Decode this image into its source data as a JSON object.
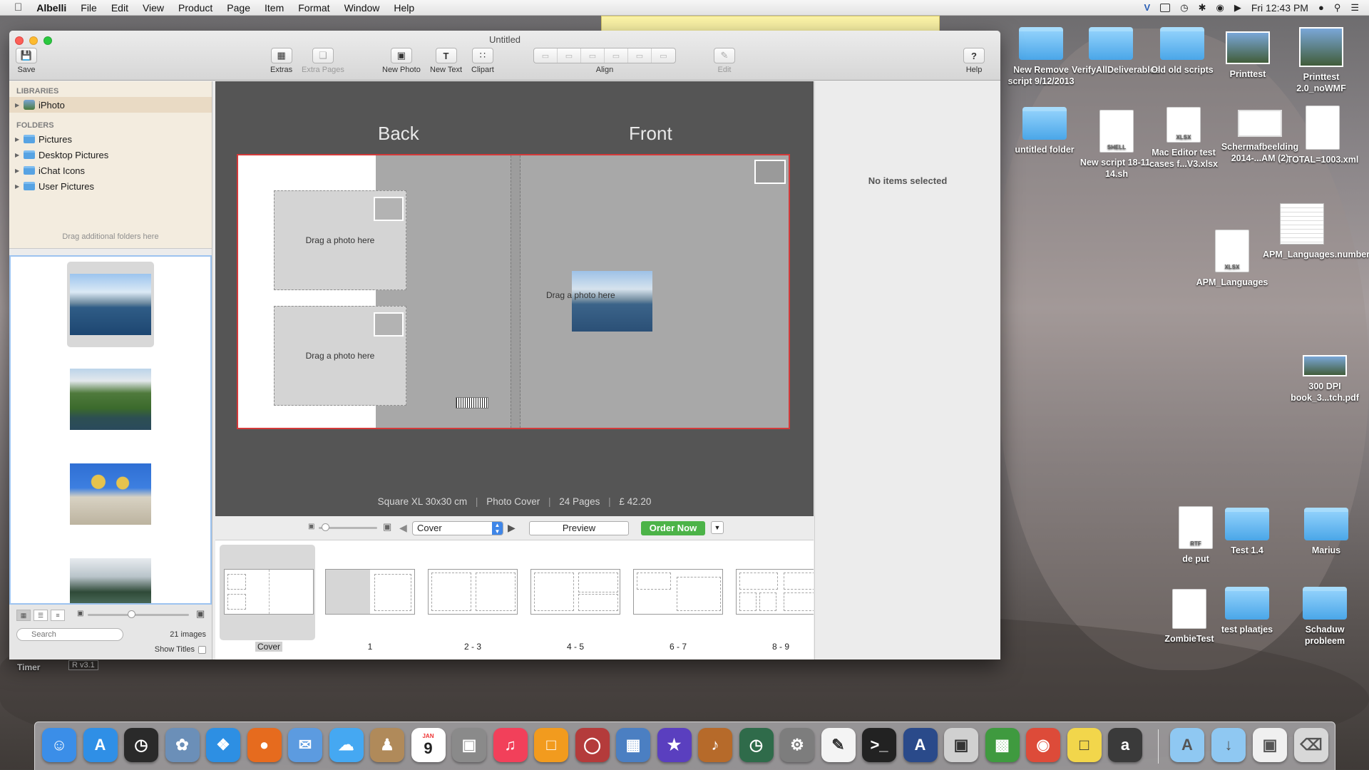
{
  "menubar": {
    "apple": "",
    "app_name": "Albelli",
    "items": [
      "File",
      "Edit",
      "View",
      "Product",
      "Page",
      "Item",
      "Format",
      "Window",
      "Help"
    ],
    "clock": "Fri 12:43 PM"
  },
  "window": {
    "title": "Untitled",
    "toolbar": {
      "save": "Save",
      "extras": "Extras",
      "extra_pages": "Extra Pages",
      "new_photo": "New Photo",
      "new_text": "New Text",
      "clipart": "Clipart",
      "align": "Align",
      "edit": "Edit",
      "help": "Help"
    }
  },
  "sidebar": {
    "libraries_header": "LIBRARIES",
    "libraries": [
      {
        "label": "iPhoto"
      }
    ],
    "folders_header": "FOLDERS",
    "folders": [
      {
        "label": "Pictures"
      },
      {
        "label": "Desktop Pictures"
      },
      {
        "label": "iChat Icons"
      },
      {
        "label": "User Pictures"
      }
    ],
    "drag_hint": "Drag additional folders here",
    "search_placeholder": "Search",
    "image_count": "21 images",
    "show_titles": "Show Titles",
    "thumbnail_size_fraction": 0.43
  },
  "editor": {
    "back_label": "Back",
    "front_label": "Front",
    "drag_photo": "Drag a photo here",
    "summary": {
      "size": "Square XL 30x30 cm",
      "cover": "Photo Cover",
      "pages": "24 Pages",
      "price": "£ 42.20"
    },
    "zoom_fraction": 0.05,
    "page_select": "Cover",
    "preview": "Preview",
    "order_now": "Order Now",
    "pages": [
      {
        "label": "Cover"
      },
      {
        "label": "1"
      },
      {
        "label": "2 - 3"
      },
      {
        "label": "4 - 5"
      },
      {
        "label": "6 - 7"
      },
      {
        "label": "8 - 9"
      }
    ]
  },
  "inspector": {
    "empty": "No items selected"
  },
  "desktop": {
    "icons": [
      {
        "label": "New Remove script 9/12/2013",
        "kind": "folder"
      },
      {
        "label": "VerifyAllDeliverables",
        "kind": "folder"
      },
      {
        "label": "Old old scripts",
        "kind": "folder"
      },
      {
        "label": "Printtest",
        "kind": "image"
      },
      {
        "label": "Printtest 2.0_noWMF",
        "kind": "image"
      },
      {
        "label": "untitled folder",
        "kind": "folder"
      },
      {
        "label": "New script 18-11-14.sh",
        "kind": "doc",
        "tag": "SHELL"
      },
      {
        "label": "Mac Editor test cases f...V3.xlsx",
        "kind": "doc",
        "tag": "XLSX"
      },
      {
        "label": "Schermafbeelding 2014-...AM (2)",
        "kind": "image"
      },
      {
        "label": "TOTAL=1003.xml",
        "kind": "doc",
        "tag": ""
      },
      {
        "label": "APM_Languages.numbers",
        "kind": "sheet"
      },
      {
        "label": "APM_Languages",
        "kind": "doc",
        "tag": "XLSX"
      },
      {
        "label": "300 DPI book_3...tch.pdf",
        "kind": "image"
      },
      {
        "label": "de put",
        "kind": "doc",
        "tag": "RTF"
      },
      {
        "label": "Test 1.4",
        "kind": "folder"
      },
      {
        "label": "Marius",
        "kind": "folder"
      },
      {
        "label": "ZombieTest",
        "kind": "doc",
        "tag": ""
      },
      {
        "label": "test plaatjes",
        "kind": "folder"
      },
      {
        "label": "Schaduw probleem",
        "kind": "folder"
      }
    ],
    "timer_label": "Timer",
    "version_label": "R v3.1"
  },
  "dock": {
    "apps": [
      "finder-icon",
      "app-store-icon",
      "dashboard-icon",
      "preview-icon",
      "safari-icon",
      "firefox-icon",
      "mail-icon",
      "messages-icon",
      "contacts-icon",
      "calendar-icon",
      "image-capture-icon",
      "itunes-icon",
      "ibooks-icon",
      "photo-booth-icon",
      "iphoto-icon",
      "imovie-icon",
      "garageband-icon",
      "time-machine-icon",
      "system-preferences-icon",
      "textedit-icon",
      "terminal-icon",
      "instruments-icon",
      "preview-docs-icon",
      "numbers-icon",
      "chrome-icon",
      "stickies-icon",
      "albelli-icon"
    ],
    "calendar_month": "JAN",
    "calendar_day": "9"
  },
  "colors": {
    "order_button": "#4cb348",
    "selection_blue": "#3f86e8",
    "cover_border": "#d43a3a"
  }
}
